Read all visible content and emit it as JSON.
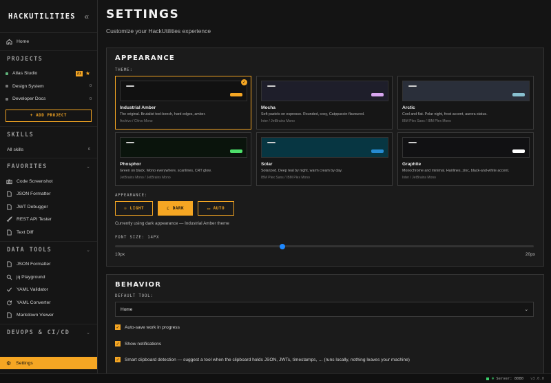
{
  "sidebar": {
    "brand": "HACKUTILITIES",
    "collapse_icon": "«",
    "home_label": "Home",
    "projects_title": "PROJECTS",
    "projects": [
      {
        "name": "Atlas Studio",
        "badge": "21",
        "starred": true,
        "count": "",
        "color": "#5fb37a"
      },
      {
        "name": "Design System",
        "count": "0",
        "color": "#777777"
      },
      {
        "name": "Developer Docs",
        "count": "0",
        "color": "#777777"
      }
    ],
    "add_project_label": "+ ADD PROJECT",
    "skills_title": "SKILLS",
    "all_skills_label": "All skills",
    "all_skills_count": "6",
    "favorites_title": "FAVORITES",
    "favorites": [
      "Code Screenshot",
      "JSON Formatter",
      "JWT Debugger",
      "REST API Tester",
      "Text Diff"
    ],
    "data_tools_title": "DATA TOOLS",
    "data_tools": [
      "JSON Formatter",
      "jq Playground",
      "YAML Validator",
      "YAML Converter",
      "Markdown Viewer"
    ],
    "devops_title": "DEVOPS & CI/CD",
    "settings_label": "Settings"
  },
  "main": {
    "title": "SETTINGS",
    "subtitle": "Customize your HackUtilities experience",
    "appearance": {
      "title": "APPEARANCE",
      "theme_label": "THEME:",
      "themes": [
        {
          "name": "Industrial Amber",
          "desc": "The original. Brutalist tool-bench, hard edges, amber.",
          "fonts": "Archivo / Chivo Mono",
          "bg": "#111111",
          "pill": "#f5a623",
          "selected": true
        },
        {
          "name": "Mocha",
          "desc": "Soft pastels on espresso. Rounded, cosy, Catppuccin-flavoured.",
          "fonts": "Inter / JetBrains Mono",
          "bg": "#1e1e2a",
          "pill": "#d8a6f0",
          "selected": false
        },
        {
          "name": "Arctic",
          "desc": "Cool and flat. Polar night, frost accent, aurora status.",
          "fonts": "IBM Plex Sans / IBM Plex Mono",
          "bg": "#2a2f3a",
          "pill": "#88c0d0",
          "selected": false
        },
        {
          "name": "Phosphor",
          "desc": "Green on black. Mono everywhere, scanlines, CRT glow.",
          "fonts": "JetBrains Mono / JetBrains Mono",
          "bg": "#0a140c",
          "pill": "#4ee06b",
          "selected": false
        },
        {
          "name": "Solar",
          "desc": "Solarized. Deep teal by night, warm cream by day.",
          "fonts": "IBM Plex Sans / IBM Plex Mono",
          "bg": "#073642",
          "pill": "#268bd2",
          "selected": false
        },
        {
          "name": "Graphite",
          "desc": "Monochrome and minimal. Hairlines, zinc, black-and-white accent.",
          "fonts": "Inter / JetBrains Mono",
          "bg": "#111113",
          "pill": "#ffffff",
          "selected": false
        }
      ],
      "mode_label": "APPEARANCE:",
      "modes": [
        {
          "label": "LIGHT",
          "icon": "sun-icon",
          "active": false
        },
        {
          "label": "DARK",
          "icon": "moon-icon",
          "active": true
        },
        {
          "label": "AUTO",
          "icon": "monitor-icon",
          "active": false
        }
      ],
      "mode_note": "Currently using dark appearance — Industrial Amber theme",
      "font_size_label": "FONT SIZE: 14PX",
      "font_size": 14,
      "font_min": 10,
      "font_max": 20,
      "font_min_label": "10px",
      "font_max_label": "20px"
    },
    "behavior": {
      "title": "BEHAVIOR",
      "default_tool_label": "DEFAULT TOOL:",
      "default_tool_value": "Home",
      "options": [
        {
          "label": "Auto-save work in progress",
          "checked": true
        },
        {
          "label": "Show notifications",
          "checked": true
        },
        {
          "label": "Smart clipboard detection — suggest a tool when the clipboard holds JSON, JWTs, timestamps, … (runs locally, nothing leaves your machine)",
          "checked": true
        }
      ]
    }
  },
  "statusbar": {
    "server": "Server: 8080",
    "version": "v3.0.0"
  },
  "colors": {
    "accent": "#f5a623",
    "slider": "#1e88ff",
    "status_ok": "#3ccf6b"
  }
}
